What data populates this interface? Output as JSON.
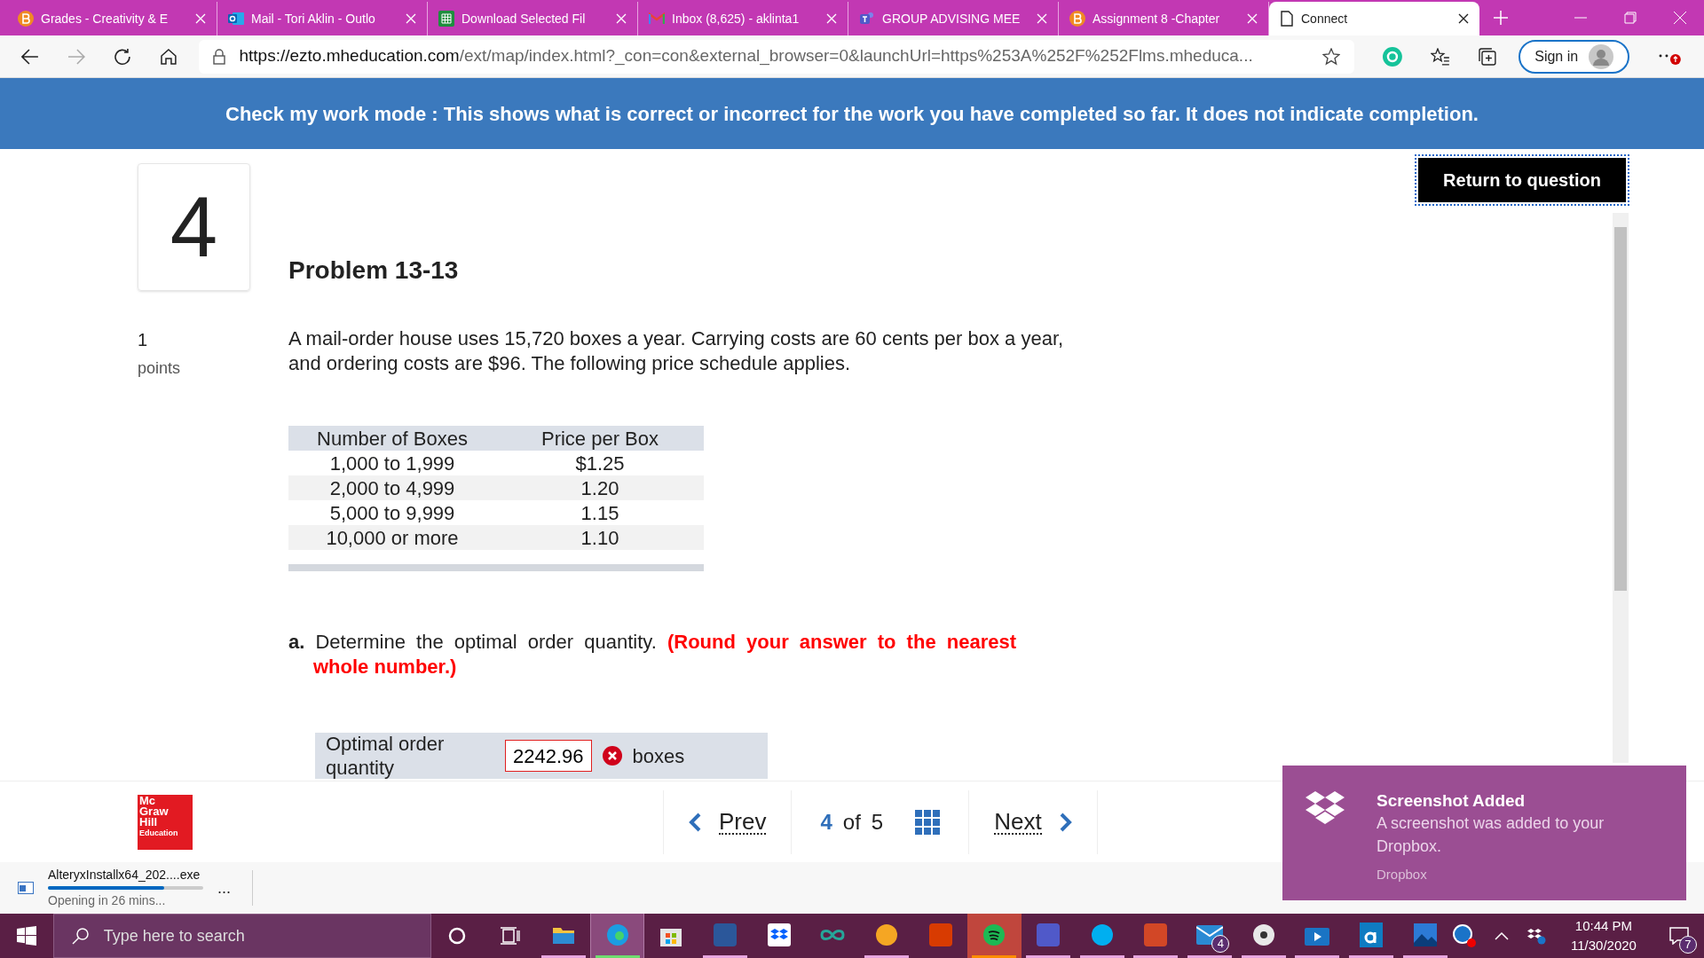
{
  "browser": {
    "tabs": [
      {
        "kind": "brightspace",
        "title": "Grades - Creativity & E",
        "selected": false
      },
      {
        "kind": "outlook",
        "title": "Mail - Tori Aklin - Outlo",
        "selected": false
      },
      {
        "kind": "sheet",
        "title": "Download Selected Fil",
        "selected": false
      },
      {
        "kind": "gmail",
        "title": "Inbox (8,625) - aklinta1",
        "selected": false
      },
      {
        "kind": "teams",
        "title": "GROUP ADVISING MEE",
        "selected": false
      },
      {
        "kind": "brightspace",
        "title": "Assignment 8 -Chapter",
        "selected": false
      },
      {
        "kind": "page",
        "title": "Connect",
        "selected": true
      }
    ],
    "url_host": "https://ezto.mheducation.com",
    "url_rest": "/ext/map/index.html?_con=con&external_browser=0&launchUrl=https%253A%252F%252Flms.mheduca...",
    "sign_in": "Sign in"
  },
  "banner": "Check my work mode : This shows what is correct or incorrect for the work you have completed so far. It does not indicate completion.",
  "question": {
    "number": "4",
    "title": "Problem 13-13",
    "points_value": "1",
    "points_label": "points",
    "text": "A mail-order house uses 15,720 boxes a year. Carrying costs are 60 cents per box a year, and ordering costs are $96. The following price schedule applies.",
    "return_button": "Return to question",
    "table": {
      "columns": [
        "Number of Boxes",
        "Price per Box"
      ],
      "rows": [
        [
          "1,000 to 1,999",
          "$1.25"
        ],
        [
          "2,000 to 4,999",
          "1.20"
        ],
        [
          "5,000 to 9,999",
          "1.15"
        ],
        [
          "10,000 or more",
          "1.10"
        ]
      ]
    },
    "part": {
      "letter": "a.",
      "prompt": "Determine the optimal order quantity.",
      "hint": "(Round your answer to the nearest whole number.)"
    },
    "answer": {
      "label": "Optimal order quantity",
      "value": "2242.96",
      "correct": false,
      "unit": "boxes"
    }
  },
  "footer": {
    "prev": "Prev",
    "current": "4",
    "of": "of",
    "total": "5",
    "next": "Next",
    "logo": [
      "Mc",
      "Graw",
      "Hill",
      "Education"
    ]
  },
  "download": {
    "file": "AlteryxInstallx64_202....exe",
    "level": 0.75,
    "status": "Opening in 26 mins...",
    "menu": "..."
  },
  "notification": {
    "title": "Screenshot Added",
    "message": "A screenshot was added to your Dropbox.",
    "source": "Dropbox"
  },
  "taskbar": {
    "search_placeholder": "Type here to search",
    "apps": [
      {
        "kind": "explorer",
        "running": true,
        "selected": false,
        "flashing": false
      },
      {
        "kind": "edge",
        "running": true,
        "selected": true,
        "flashing": false
      },
      {
        "kind": "store",
        "running": false,
        "selected": false,
        "flashing": false
      },
      {
        "kind": "word",
        "running": true,
        "selected": false,
        "flashing": false
      },
      {
        "kind": "dropbox",
        "running": false,
        "selected": false,
        "flashing": false
      },
      {
        "kind": "infinity",
        "running": false,
        "selected": false,
        "flashing": false
      },
      {
        "kind": "vpn",
        "running": true,
        "selected": false,
        "flashing": false
      },
      {
        "kind": "office",
        "running": false,
        "selected": false,
        "flashing": false
      },
      {
        "kind": "spotify",
        "running": true,
        "selected": false,
        "flashing": true
      },
      {
        "kind": "teams",
        "running": true,
        "selected": false,
        "flashing": false
      },
      {
        "kind": "skype",
        "running": true,
        "selected": false,
        "flashing": false
      },
      {
        "kind": "powerpoint",
        "running": true,
        "selected": false,
        "flashing": false
      },
      {
        "kind": "mail",
        "running": true,
        "selected": false,
        "flashing": false,
        "badge": "4"
      },
      {
        "kind": "media",
        "running": true,
        "selected": false,
        "flashing": false
      },
      {
        "kind": "films",
        "running": true,
        "selected": false,
        "flashing": false
      },
      {
        "kind": "amazon",
        "running": true,
        "selected": false,
        "flashing": false
      },
      {
        "kind": "photos",
        "running": true,
        "selected": false,
        "flashing": false
      }
    ],
    "time": "10:44 PM",
    "date": "11/30/2020",
    "notifications_badge": "7"
  }
}
